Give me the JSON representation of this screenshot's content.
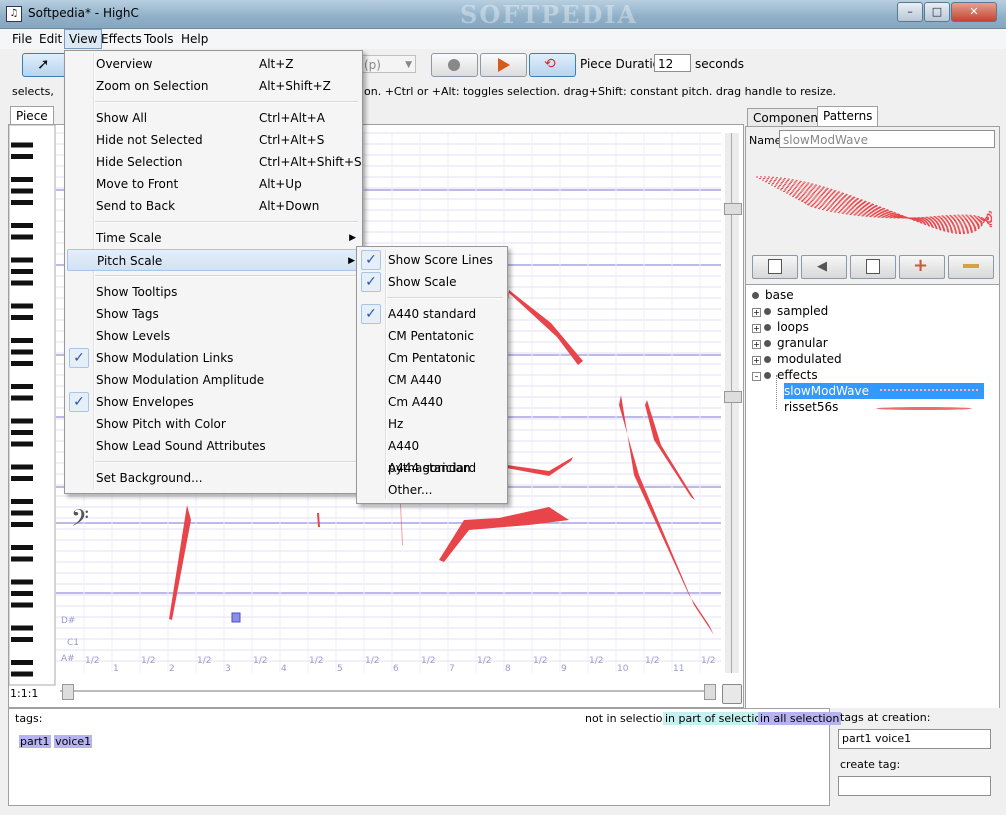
{
  "window": {
    "title": "Softpedia* - HighC",
    "watermark": "SOFTPEDIA"
  },
  "menubar": [
    "File",
    "Edit",
    "View",
    "Effects",
    "Tools",
    "Help"
  ],
  "toolbar": {
    "mode_select": "(p)",
    "piece_duration_label": "Piece Duration:",
    "piece_duration_value": "12",
    "seconds_label": "seconds"
  },
  "hint": {
    "left": "selects,",
    "right": "on. +Ctrl or +Alt: toggles selection. drag+Shift: constant pitch. drag handle to resize."
  },
  "piece_tab": "Piece",
  "view_menu": [
    {
      "label": "Overview",
      "shortcut": "Alt+Z"
    },
    {
      "label": "Zoom on Selection",
      "shortcut": "Alt+Shift+Z"
    },
    {
      "sep": true
    },
    {
      "label": "Show All",
      "shortcut": "Ctrl+Alt+A"
    },
    {
      "label": "Hide not Selected",
      "shortcut": "Ctrl+Alt+S"
    },
    {
      "label": "Hide Selection",
      "shortcut": "Ctrl+Alt+Shift+S"
    },
    {
      "label": "Move to Front",
      "shortcut": "Alt+Up"
    },
    {
      "label": "Send to Back",
      "shortcut": "Alt+Down"
    },
    {
      "sep": true
    },
    {
      "label": "Time Scale",
      "submenu": true
    },
    {
      "label": "Pitch Scale",
      "submenu": true,
      "highlighted": true
    },
    {
      "sep": true
    },
    {
      "label": "Show Tooltips"
    },
    {
      "label": "Show Tags"
    },
    {
      "label": "Show Levels"
    },
    {
      "label": "Show Modulation Links",
      "checked": true
    },
    {
      "label": "Show Modulation Amplitude"
    },
    {
      "label": "Show Envelopes",
      "checked": true
    },
    {
      "label": "Show Pitch with Color"
    },
    {
      "label": "Show Lead Sound Attributes"
    },
    {
      "sep": true
    },
    {
      "label": "Set Background..."
    }
  ],
  "pitch_submenu": [
    {
      "label": "Show Score Lines",
      "checked": true
    },
    {
      "label": "Show Scale",
      "checked": true
    },
    {
      "sep": true
    },
    {
      "label": "A440 standard",
      "checked": true
    },
    {
      "label": "CM Pentatonic"
    },
    {
      "label": "Cm Pentatonic"
    },
    {
      "label": "CM A440"
    },
    {
      "label": "Cm A440"
    },
    {
      "label": "Hz"
    },
    {
      "label": "A440 pythagorician"
    },
    {
      "label": "A444 standard"
    },
    {
      "label": "Other..."
    }
  ],
  "score": {
    "position": "1:1:1",
    "ticks": [
      "1/2",
      "1",
      "1/2",
      "2",
      "1/2",
      "3",
      "1/2",
      "4",
      "1/2",
      "5",
      "1/2",
      "6",
      "1/2",
      "7",
      "1/2",
      "8",
      "1/2",
      "9",
      "1/2",
      "10",
      "1/2",
      "11",
      "1/2"
    ],
    "note_labels": [
      "C1",
      "A#",
      "D#"
    ]
  },
  "right_panel": {
    "tabs": [
      "Components",
      "Patterns"
    ],
    "name_label": "Name:",
    "name_value": "slowModWave",
    "tree": [
      {
        "label": "base",
        "level": 0
      },
      {
        "label": "sampled",
        "level": 1
      },
      {
        "label": "loops",
        "level": 1
      },
      {
        "label": "granular",
        "level": 1
      },
      {
        "label": "modulated",
        "level": 1
      },
      {
        "label": "effects",
        "level": 1
      },
      {
        "label": "slowModWave",
        "level": 2,
        "selected": true
      },
      {
        "label": "risset56s",
        "level": 2
      }
    ]
  },
  "bottom": {
    "tags_label": "tags:",
    "legend_not": "not in selection",
    "legend_part": "in part of selection",
    "legend_all": "in all selection",
    "tags": [
      "part1",
      "voice1"
    ],
    "tags_at_creation_label": "tags at creation:",
    "tags_at_creation_value": "part1 voice1",
    "create_tag_label": "create tag:"
  },
  "colors": {
    "note": "#e8454a",
    "grid": "#c8c8e8",
    "selection": "#3399ff"
  }
}
